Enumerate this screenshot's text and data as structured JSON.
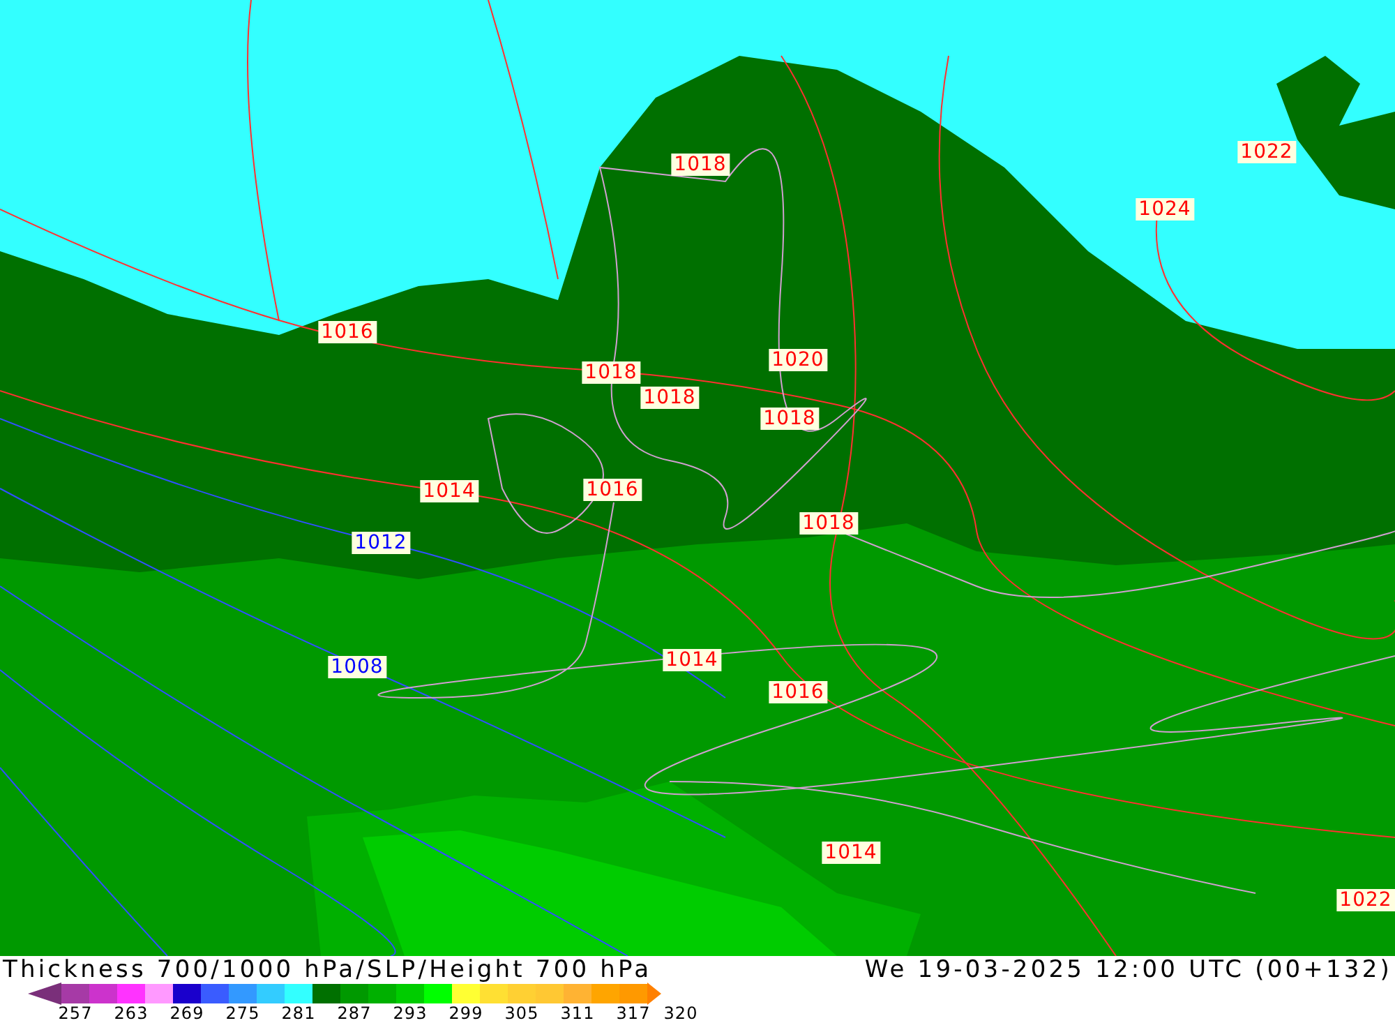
{
  "map": {
    "isobar_labels": [
      {
        "text": "1018",
        "color": "#ff0000"
      },
      {
        "text": "1022",
        "color": "#ff0000"
      },
      {
        "text": "1024",
        "color": "#ff0000"
      },
      {
        "text": "1016",
        "color": "#ff0000"
      },
      {
        "text": "1018",
        "color": "#ff0000"
      },
      {
        "text": "1020",
        "color": "#ff0000"
      },
      {
        "text": "1018",
        "color": "#ff0000"
      },
      {
        "text": "1018",
        "color": "#ff0000"
      },
      {
        "text": "1014",
        "color": "#ff0000"
      },
      {
        "text": "1016",
        "color": "#ff0000"
      },
      {
        "text": "1018",
        "color": "#ff0000"
      },
      {
        "text": "1012",
        "color": "#0000ff"
      },
      {
        "text": "1014",
        "color": "#ff0000"
      },
      {
        "text": "1008",
        "color": "#0000ff"
      },
      {
        "text": "1016",
        "color": "#ff0000"
      },
      {
        "text": "1014",
        "color": "#ff0000"
      },
      {
        "text": "1022",
        "color": "#ff0000"
      }
    ]
  },
  "title": "Thickness 700/1000 hPa/SLP/Height 700 hPa",
  "valid_time": "We 19-03-2025 12:00 UTC (00+132)",
  "legend": {
    "swatches": [
      {
        "color": "#a63aa6"
      },
      {
        "color": "#cc33cc"
      },
      {
        "color": "#ff33ff"
      },
      {
        "color": "#ff99ff"
      },
      {
        "color": "#1a00cc"
      },
      {
        "color": "#3a5cff"
      },
      {
        "color": "#3399ff"
      },
      {
        "color": "#33ccff"
      },
      {
        "color": "#33ffff"
      },
      {
        "color": "#007000"
      },
      {
        "color": "#009900"
      },
      {
        "color": "#00b000"
      },
      {
        "color": "#00cc00"
      },
      {
        "color": "#00ff00"
      },
      {
        "color": "#ffff33"
      },
      {
        "color": "#ffe033"
      },
      {
        "color": "#ffd033"
      },
      {
        "color": "#ffc833"
      },
      {
        "color": "#ffb333"
      },
      {
        "color": "#ffa500"
      },
      {
        "color": "#ff9900"
      }
    ],
    "ticks": [
      "257",
      "263",
      "269",
      "275",
      "281",
      "287",
      "293",
      "299",
      "305",
      "311",
      "317",
      "320"
    ]
  }
}
